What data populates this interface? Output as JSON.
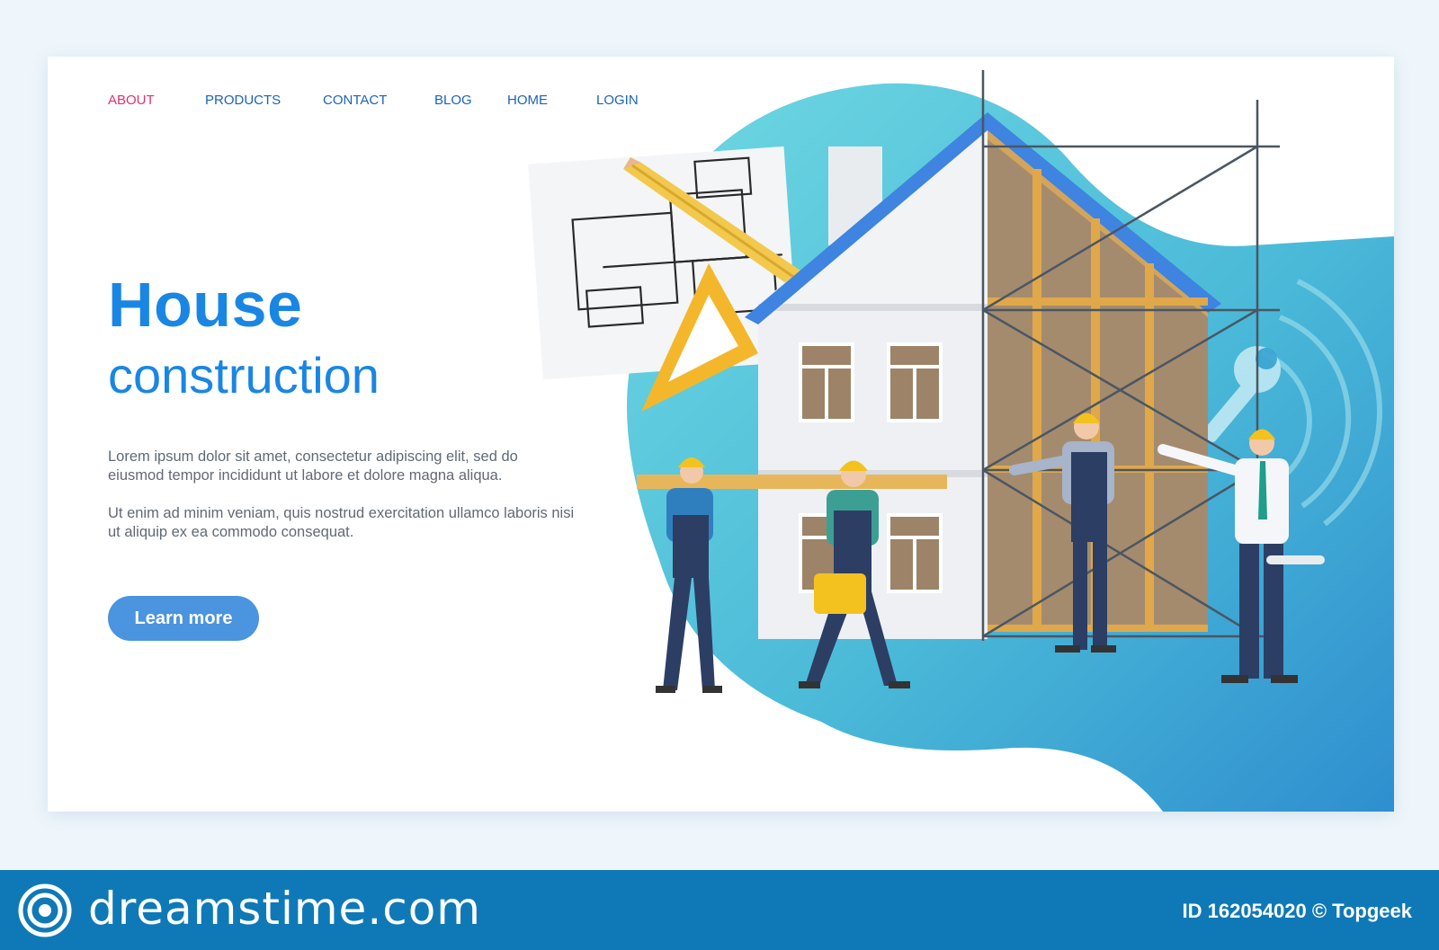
{
  "nav": {
    "items": [
      {
        "label": "ABOUT"
      },
      {
        "label": "PRODUCTS"
      },
      {
        "label": "CONTACT"
      },
      {
        "label": "BLOG"
      },
      {
        "label": "HOME"
      },
      {
        "label": "LOGIN"
      }
    ],
    "active_color": "#e0306f",
    "link_color": "#1b63b8"
  },
  "hero": {
    "title_line1": "House",
    "title_line2": "construction",
    "paragraph1": "Lorem ipsum dolor sit amet, consectetur adipiscing elit, sed do eiusmod tempor incididunt ut labore et dolore magna aliqua.",
    "paragraph2": "Ut enim ad minim veniam, quis nostrud exercitation ullamco laboris nisi ut aliquip ex ea commodo consequat.",
    "button_label": "Learn more",
    "accent_color": "#1a86e4"
  },
  "footer": {
    "brand": "dreamstime.com",
    "image_id": "ID 162054020 © Topgeek",
    "background_color": "#0f79b7"
  }
}
